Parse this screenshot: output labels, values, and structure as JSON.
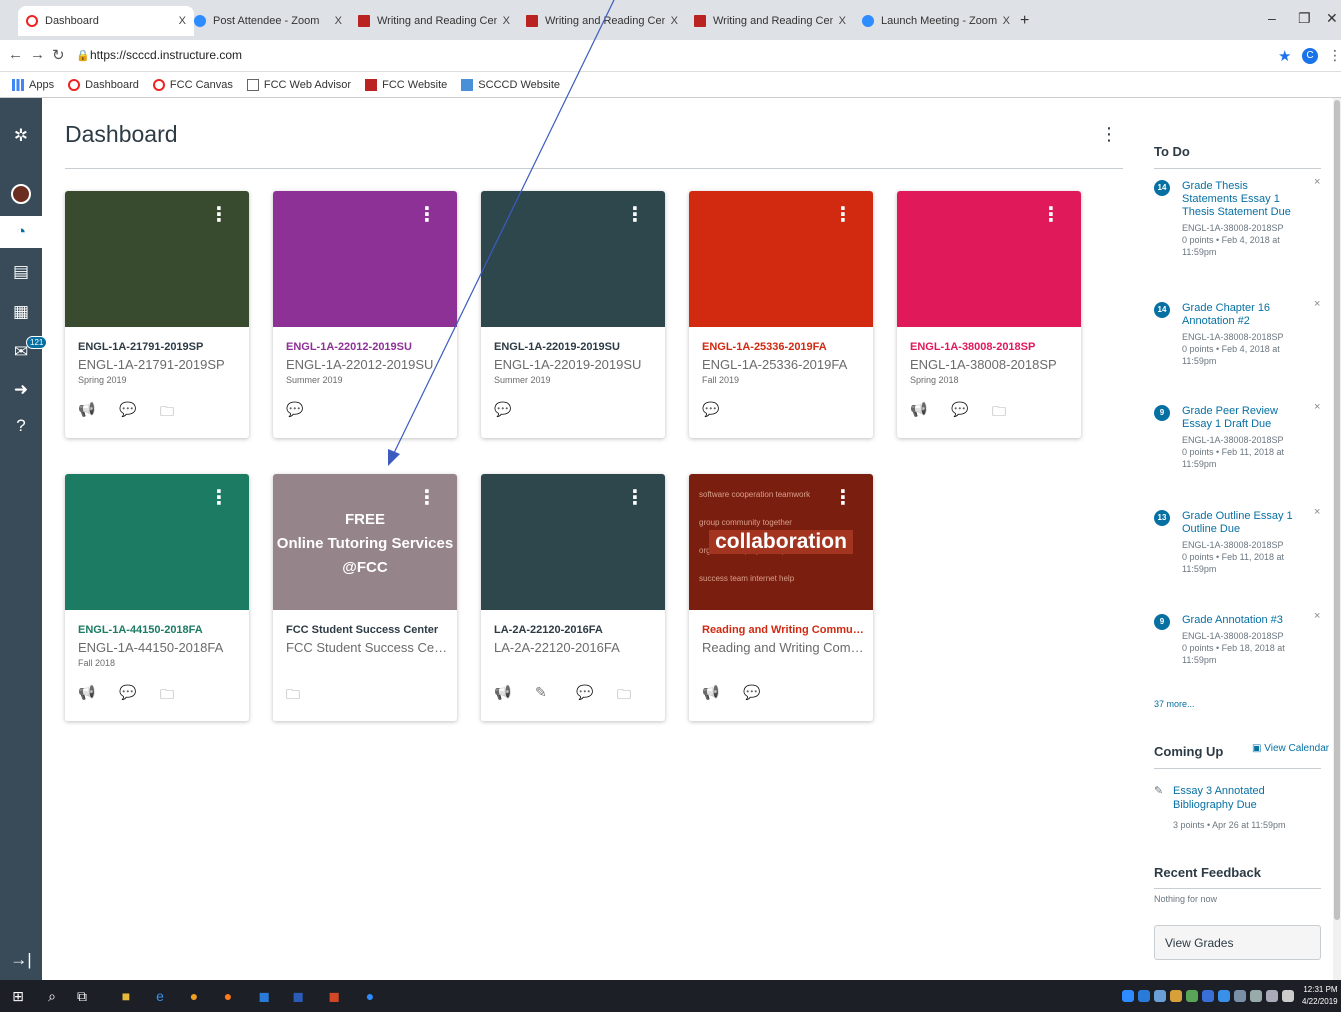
{
  "browser": {
    "tabs": [
      {
        "label": "Dashboard",
        "favicon": "canvas",
        "active": true
      },
      {
        "label": "Post Attendee - Zoom",
        "favicon": "zoom"
      },
      {
        "label": "Writing and Reading Center | Fre",
        "favicon": "frc"
      },
      {
        "label": "Writing and Reading Center | Fre",
        "favicon": "frc"
      },
      {
        "label": "Writing and Reading Center | Fre",
        "favicon": "frc"
      },
      {
        "label": "Launch Meeting - Zoom",
        "favicon": "zoom"
      }
    ],
    "close_glyph": "X",
    "new_tab": "+",
    "url": "https://scccd.instructure.com",
    "profile_initial": "C",
    "bookmarks": [
      {
        "label": "Apps",
        "icon": "apps"
      },
      {
        "label": "Dashboard",
        "icon": "canvas"
      },
      {
        "label": "FCC Canvas",
        "icon": "canvas"
      },
      {
        "label": "FCC Web Advisor",
        "icon": "doc"
      },
      {
        "label": "FCC Website",
        "icon": "frc"
      },
      {
        "label": "SCCCD Website",
        "icon": "scccd"
      }
    ]
  },
  "nav": {
    "inbox_count": "121"
  },
  "dashboard": {
    "title": "Dashboard",
    "cards": [
      {
        "code": "ENGL-1A-21791-2019SP",
        "name": "ENGL-1A-21791-2019SP",
        "term": "Spring 2019",
        "color": "#394b2f",
        "code_color": "#2d3b45",
        "icons": [
          "announcements",
          "discussions",
          "files"
        ]
      },
      {
        "code": "ENGL-1A-22012-2019SU",
        "name": "ENGL-1A-22012-2019SU",
        "term": "Summer 2019",
        "color": "#8e3197",
        "code_color": "#8e3197",
        "icons": [
          "discussions"
        ]
      },
      {
        "code": "ENGL-1A-22019-2019SU",
        "name": "ENGL-1A-22019-2019SU",
        "term": "Summer 2019",
        "color": "#2e474d",
        "code_color": "#2d3b45",
        "icons": [
          "discussions"
        ]
      },
      {
        "code": "ENGL-1A-25336-2019FA",
        "name": "ENGL-1A-25336-2019FA",
        "term": "Fall 2019",
        "color": "#d12a10",
        "code_color": "#d12a10",
        "icons": [
          "discussions"
        ]
      },
      {
        "code": "ENGL-1A-38008-2018SP",
        "name": "ENGL-1A-38008-2018SP",
        "term": "Spring 2018",
        "color": "#e0195a",
        "code_color": "#e0195a",
        "icons": [
          "announcements",
          "discussions",
          "files"
        ]
      },
      {
        "code": "ENGL-1A-44150-2018FA",
        "name": "ENGL-1A-44150-2018FA",
        "term": "Fall 2018",
        "color": "#1b7b63",
        "code_color": "#1b7b63",
        "icons": [
          "announcements",
          "discussions",
          "files"
        ]
      },
      {
        "code": "FCC Student Success Center",
        "name": "FCC Student Success Center",
        "term": "",
        "color": "#958489",
        "code_color": "#2d3b45",
        "icons": [
          "files"
        ],
        "hero_lines": [
          "FREE",
          "Online Tutoring Services",
          "@FCC"
        ]
      },
      {
        "code": "LA-2A-22120-2016FA",
        "name": "LA-2A-22120-2016FA",
        "term": "",
        "color": "#2e474d",
        "code_color": "#2d3b45",
        "icons": [
          "announcements",
          "assignments",
          "discussions",
          "files"
        ]
      },
      {
        "code": "Reading and Writing Community o...",
        "name": "Reading and Writing Commun...",
        "term": "",
        "color": "#7a1e10",
        "code_color": "#d12a10",
        "icons": [
          "announcements",
          "discussions"
        ],
        "hero_word": "collaboration"
      }
    ]
  },
  "sidebar": {
    "todo_title": "To Do",
    "todo": [
      {
        "badge": "14",
        "title": "Grade Thesis Statements Essay 1 Thesis Statement Due",
        "course": "ENGL-1A-38008-2018SP",
        "meta": "0 points • Feb 4, 2018 at 11:59pm"
      },
      {
        "badge": "14",
        "title": "Grade Chapter 16 Annotation #2",
        "course": "ENGL-1A-38008-2018SP",
        "meta": "0 points • Feb 4, 2018 at 11:59pm"
      },
      {
        "badge": "9",
        "title": "Grade Peer Review Essay 1 Draft Due",
        "course": "ENGL-1A-38008-2018SP",
        "meta": "0 points • Feb 11, 2018 at 11:59pm"
      },
      {
        "badge": "13",
        "title": "Grade Outline Essay 1 Outline Due",
        "course": "ENGL-1A-38008-2018SP",
        "meta": "0 points • Feb 11, 2018 at 11:59pm"
      },
      {
        "badge": "9",
        "title": "Grade Annotation #3",
        "course": "ENGL-1A-38008-2018SP",
        "meta": "0 points • Feb 18, 2018 at 11:59pm"
      }
    ],
    "more": "37 more...",
    "coming_up_title": "Coming Up",
    "view_calendar": "View Calendar",
    "coming_up_item": {
      "title": "Essay 3 Annotated Bibliography Due",
      "meta": "3 points • Apr 26 at 11:59pm"
    },
    "recent_feedback_title": "Recent Feedback",
    "recent_feedback_text": "Nothing for now",
    "view_grades": "View Grades"
  },
  "taskbar": {
    "time": "12:31 PM",
    "date": "4/22/2019"
  }
}
